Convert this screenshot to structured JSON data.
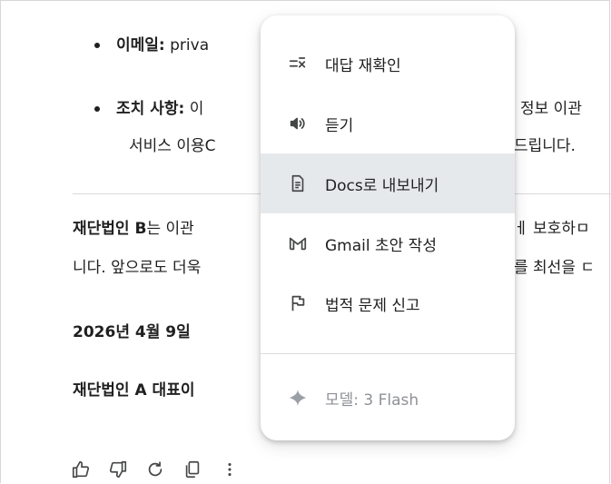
{
  "document": {
    "bullet_email_label": "이메일:",
    "bullet_email_text": "priva",
    "bullet_action_label": "조치 사항:",
    "bullet_action_text_left": "이",
    "bullet_action_text_right": "정보 이관",
    "bullet_action_line2_left": "서비스 이용C",
    "bullet_action_line2_right": "드립니다.",
    "para_line1_bold": "재단법인 B",
    "para_line1_text": "는 이관",
    "para_line1_right": "ㅔ 보호하ㅁ",
    "para_line2_left": "니다. 앞으로도 더욱",
    "para_line2_right": "를 최선을 ㄷ",
    "date": "2026년 4월 9일",
    "signature": "재단법인 A 대표이"
  },
  "menu": {
    "items": [
      {
        "label": "대답 재확인",
        "icon": "double-check-icon"
      },
      {
        "label": "듣기",
        "icon": "speaker-icon"
      },
      {
        "label": "Docs로 내보내기",
        "icon": "docs-icon",
        "selected": true
      },
      {
        "label": "Gmail 초안 작성",
        "icon": "gmail-icon"
      },
      {
        "label": "법적 문제 신고",
        "icon": "flag-icon"
      }
    ],
    "model_label": "모델: 3 Flash",
    "model_icon": "sparkle-icon"
  },
  "actions": {
    "icons": [
      "thumbs-up-icon",
      "thumbs-down-icon",
      "redo-icon",
      "copy-icon",
      "more-vert-icon"
    ]
  },
  "colors": {
    "menu_selected_bg": "#e6e9ec",
    "disabled_text": "#8e9196",
    "text": "#1f1f1f"
  }
}
